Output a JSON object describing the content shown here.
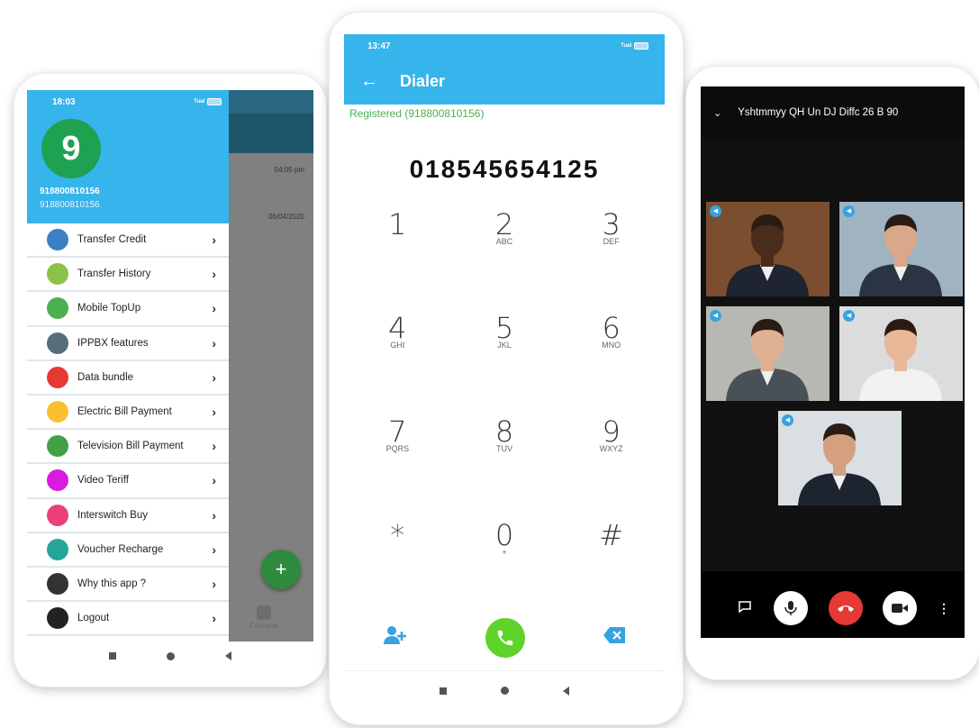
{
  "phone1": {
    "status_time": "18:03",
    "signal": "ᵀᵘᵃˡ",
    "avatar_letter": "9",
    "number_primary": "918800810156",
    "number_secondary": "918800810156",
    "bg_time_1": "04:05 pm",
    "bg_date_2": "06/04/2020",
    "bg_contacts_label": "Contacts",
    "fab_symbol": "+",
    "menu": [
      {
        "label": "Transfer Credit",
        "icon": "transfer-credit-icon",
        "color": "#3b7fc4"
      },
      {
        "label": "Transfer History",
        "icon": "transfer-history-icon",
        "color": "#8bc34a"
      },
      {
        "label": "Mobile TopUp",
        "icon": "mobile-topup-icon",
        "color": "#4caf50"
      },
      {
        "label": "IPPBX features",
        "icon": "ippbx-icon",
        "color": "#546e7a"
      },
      {
        "label": "Data bundle",
        "icon": "wifi-icon",
        "color": "#e53935"
      },
      {
        "label": "Electric Bill Payment",
        "icon": "bulb-icon",
        "color": "#fbc02d"
      },
      {
        "label": "Television Bill Payment",
        "icon": "tv-icon",
        "color": "#43a047"
      },
      {
        "label": "Video Teriff",
        "icon": "video-icon",
        "color": "#d81bdf"
      },
      {
        "label": "Interswitch Buy",
        "icon": "chart-icon",
        "color": "#ec407a"
      },
      {
        "label": "Voucher Recharge",
        "icon": "voucher-icon",
        "color": "#26a69a"
      },
      {
        "label": "Why this app ?",
        "icon": "question-icon",
        "color": "#333333"
      },
      {
        "label": "Logout",
        "icon": "logout-icon",
        "color": "#222222"
      }
    ]
  },
  "phone2": {
    "status_time": "13:47",
    "title": "Dialer",
    "registered": "Registered (918800810156)",
    "number": "018545654125",
    "keys": [
      {
        "digit": "1",
        "letters": ""
      },
      {
        "digit": "2",
        "letters": "ABC"
      },
      {
        "digit": "3",
        "letters": "DEF"
      },
      {
        "digit": "4",
        "letters": "GHI"
      },
      {
        "digit": "5",
        "letters": "JKL"
      },
      {
        "digit": "6",
        "letters": "MNO"
      },
      {
        "digit": "7",
        "letters": "PQRS"
      },
      {
        "digit": "8",
        "letters": "TUV"
      },
      {
        "digit": "9",
        "letters": "WXYZ"
      },
      {
        "digit": "*",
        "letters": ""
      },
      {
        "digit": "0",
        "letters": "+"
      },
      {
        "digit": "#",
        "letters": ""
      }
    ]
  },
  "phone3": {
    "title": "Yshtmmyy QH Un DJ Diffc 26 B 90",
    "participants": [
      {
        "name": "participant-1",
        "bg": "#7a4e2e",
        "suit": "#1e2430",
        "skin": "#4a2c1c"
      },
      {
        "name": "participant-2",
        "bg": "#9fb3c2",
        "suit": "#2a3444",
        "skin": "#d9a88a"
      },
      {
        "name": "participant-3",
        "bg": "#b8b8b2",
        "suit": "#4a5058",
        "skin": "#e0b092"
      },
      {
        "name": "participant-4",
        "bg": "#dcdcdc",
        "suit": "#f2f2f2",
        "skin": "#e8b898"
      },
      {
        "name": "participant-5",
        "bg": "#d9dfe3",
        "suit": "#1d2430",
        "skin": "#d4a080"
      }
    ]
  }
}
